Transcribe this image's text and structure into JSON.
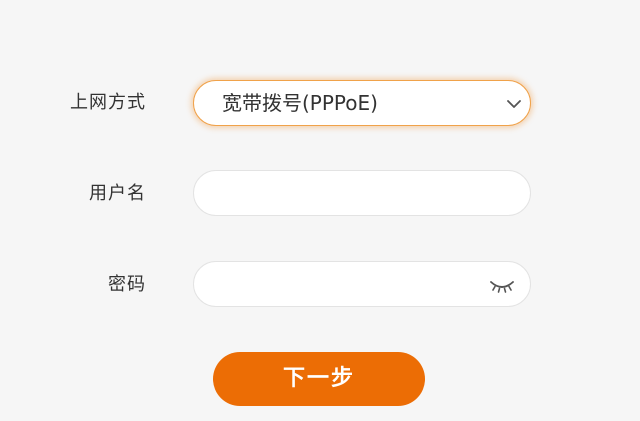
{
  "form": {
    "connection_type": {
      "label": "上网方式",
      "selected": "宽带拨号(PPPoE)",
      "icon": "chevron-down-icon"
    },
    "username": {
      "label": "用户名",
      "value": "",
      "placeholder": ""
    },
    "password": {
      "label": "密码",
      "value": "",
      "placeholder": "",
      "icon": "eye-closed-icon"
    },
    "next_button_label": "下一步"
  },
  "colors": {
    "background": "#f6f6f6",
    "accent": "#ec6d05",
    "focus_glow": "#f0a24a",
    "field_border": "#e3e3e3",
    "icon": "#555555"
  }
}
